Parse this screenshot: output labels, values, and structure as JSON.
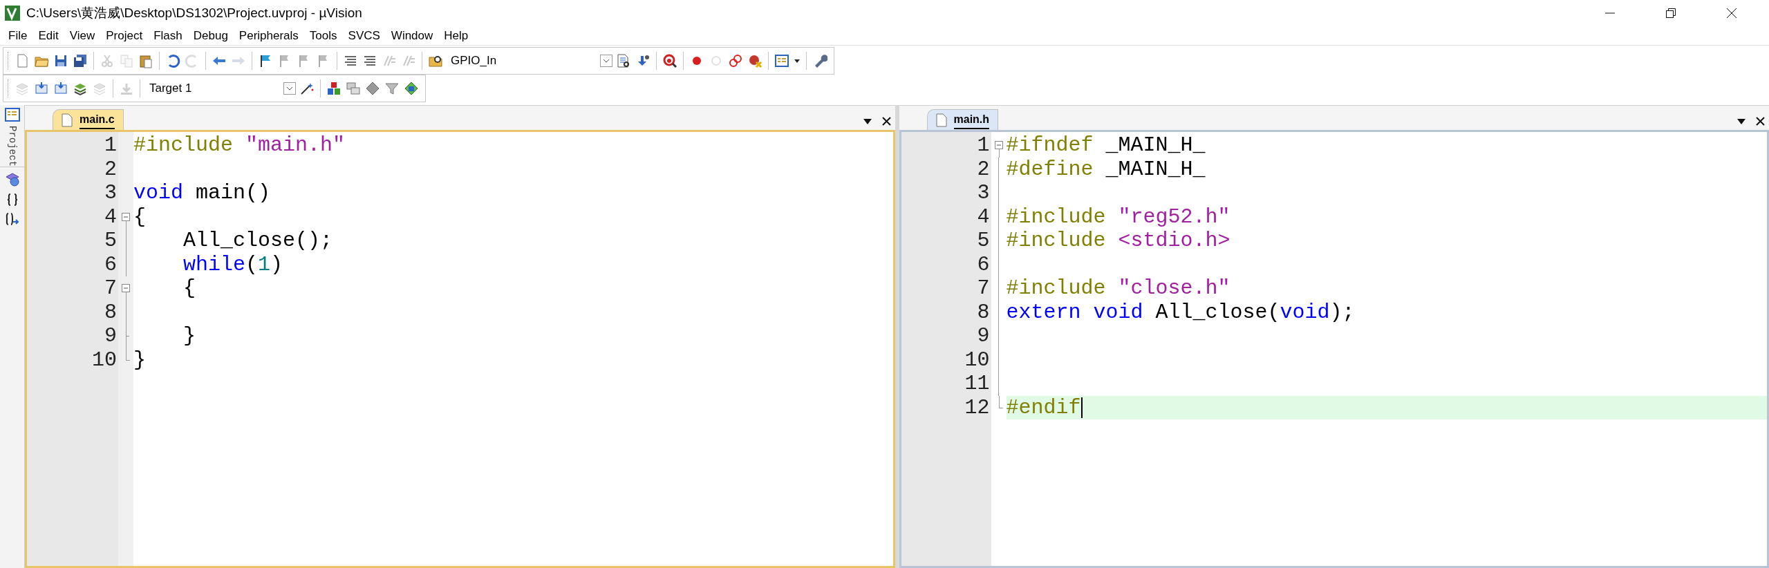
{
  "window": {
    "title": "C:\\Users\\黄浩威\\Desktop\\DS1302\\Project.uvproj - µVision"
  },
  "menu": [
    "File",
    "Edit",
    "View",
    "Project",
    "Flash",
    "Debug",
    "Peripherals",
    "Tools",
    "SVCS",
    "Window",
    "Help"
  ],
  "toolbar": {
    "target_combo": "GPIO_In"
  },
  "build_toolbar": {
    "target_combo": "Target 1"
  },
  "sidebar": {
    "label": "Project"
  },
  "panes": [
    {
      "tab": {
        "label": "main.c",
        "selected": true
      },
      "focused": true,
      "lines": [
        {
          "number": "1",
          "fold_open": false,
          "fold_close": false,
          "current": false,
          "tokens": [
            {
              "kind": "preprocessor",
              "text": "#include"
            },
            {
              "kind": "string",
              "text": " \"main.h\""
            }
          ]
        },
        {
          "number": "2",
          "fold_open": false,
          "fold_close": false,
          "current": false
        },
        {
          "number": "3",
          "fold_open": false,
          "fold_close": false,
          "current": false,
          "tokens": [
            {
              "kind": "keyword",
              "text": "void"
            },
            {
              "kind": "plain",
              "text": " main()"
            }
          ]
        },
        {
          "number": "4",
          "fold_open": true,
          "fold_close": false,
          "current": false,
          "tokens": [
            {
              "kind": "plain",
              "text": "{"
            }
          ]
        },
        {
          "number": "5",
          "fold_open": false,
          "fold_close": false,
          "current": false,
          "tokens": [
            {
              "kind": "plain",
              "text": "    All_close();"
            }
          ]
        },
        {
          "number": "6",
          "fold_open": false,
          "fold_close": false,
          "current": false,
          "tokens": [
            {
              "kind": "keyword",
              "text": "    while"
            },
            {
              "kind": "plain",
              "text": "("
            },
            {
              "kind": "number",
              "text": "1"
            },
            {
              "kind": "plain",
              "text": ")"
            }
          ]
        },
        {
          "number": "7",
          "fold_open": true,
          "fold_close": false,
          "current": false,
          "tokens": [
            {
              "kind": "plain",
              "text": "    {"
            }
          ]
        },
        {
          "number": "8",
          "fold_open": false,
          "fold_close": false,
          "current": false
        },
        {
          "number": "9",
          "fold_open": false,
          "fold_close": true,
          "current": false,
          "tokens": [
            {
              "kind": "plain",
              "text": "    }"
            }
          ]
        },
        {
          "number": "10",
          "fold_open": false,
          "fold_close": true,
          "current": false,
          "tokens": [
            {
              "kind": "plain",
              "text": "}"
            }
          ]
        }
      ]
    },
    {
      "tab": {
        "label": "main.h",
        "selected": true
      },
      "focused": false,
      "lines": [
        {
          "number": "1",
          "fold_open": true,
          "fold_close": false,
          "current": false,
          "tokens": [
            {
              "kind": "preprocessor",
              "text": "#ifndef"
            },
            {
              "kind": "plain",
              "text": " _MAIN_H_"
            }
          ]
        },
        {
          "number": "2",
          "fold_open": false,
          "fold_close": false,
          "current": false,
          "tokens": [
            {
              "kind": "preprocessor",
              "text": "#define"
            },
            {
              "kind": "plain",
              "text": " _MAIN_H_"
            }
          ]
        },
        {
          "number": "3",
          "fold_open": false,
          "fold_close": false,
          "current": false
        },
        {
          "number": "4",
          "fold_open": false,
          "fold_close": false,
          "current": false,
          "tokens": [
            {
              "kind": "preprocessor",
              "text": "#include"
            },
            {
              "kind": "string",
              "text": " \"reg52.h\""
            }
          ]
        },
        {
          "number": "5",
          "fold_open": false,
          "fold_close": false,
          "current": false,
          "tokens": [
            {
              "kind": "preprocessor",
              "text": "#include"
            },
            {
              "kind": "string",
              "text": " <stdio.h>"
            }
          ]
        },
        {
          "number": "6",
          "fold_open": false,
          "fold_close": false,
          "current": false
        },
        {
          "number": "7",
          "fold_open": false,
          "fold_close": false,
          "current": false,
          "tokens": [
            {
              "kind": "preprocessor",
              "text": "#include"
            },
            {
              "kind": "string",
              "text": " \"close.h\""
            }
          ]
        },
        {
          "number": "8",
          "fold_open": false,
          "fold_close": false,
          "current": false,
          "tokens": [
            {
              "kind": "keyword",
              "text": "extern"
            },
            {
              "kind": "keyword",
              "text": " void"
            },
            {
              "kind": "plain",
              "text": " All_close("
            },
            {
              "kind": "keyword",
              "text": "void"
            },
            {
              "kind": "plain",
              "text": ");"
            }
          ]
        },
        {
          "number": "9",
          "fold_open": false,
          "fold_close": false,
          "current": false
        },
        {
          "number": "10",
          "fold_open": false,
          "fold_close": false,
          "current": false
        },
        {
          "number": "11",
          "fold_open": false,
          "fold_close": false,
          "current": false
        },
        {
          "number": "12",
          "fold_open": false,
          "fold_close": true,
          "current": true,
          "tokens": [
            {
              "kind": "preprocessor",
              "text": "#endif"
            }
          ]
        }
      ]
    }
  ]
}
